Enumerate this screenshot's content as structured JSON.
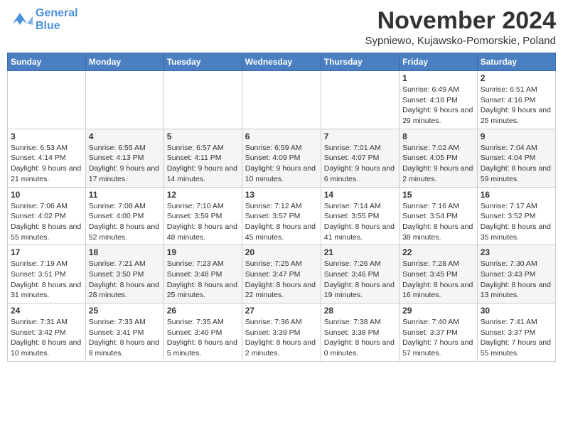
{
  "logo": {
    "line1": "General",
    "line2": "Blue"
  },
  "title": "November 2024",
  "location": "Sypniewo, Kujawsko-Pomorskie, Poland",
  "days_of_week": [
    "Sunday",
    "Monday",
    "Tuesday",
    "Wednesday",
    "Thursday",
    "Friday",
    "Saturday"
  ],
  "weeks": [
    {
      "days": [
        {
          "num": "",
          "info": ""
        },
        {
          "num": "",
          "info": ""
        },
        {
          "num": "",
          "info": ""
        },
        {
          "num": "",
          "info": ""
        },
        {
          "num": "",
          "info": ""
        },
        {
          "num": "1",
          "info": "Sunrise: 6:49 AM\nSunset: 4:18 PM\nDaylight: 9 hours and 29 minutes."
        },
        {
          "num": "2",
          "info": "Sunrise: 6:51 AM\nSunset: 4:16 PM\nDaylight: 9 hours and 25 minutes."
        }
      ]
    },
    {
      "days": [
        {
          "num": "3",
          "info": "Sunrise: 6:53 AM\nSunset: 4:14 PM\nDaylight: 9 hours and 21 minutes."
        },
        {
          "num": "4",
          "info": "Sunrise: 6:55 AM\nSunset: 4:13 PM\nDaylight: 9 hours and 17 minutes."
        },
        {
          "num": "5",
          "info": "Sunrise: 6:57 AM\nSunset: 4:11 PM\nDaylight: 9 hours and 14 minutes."
        },
        {
          "num": "6",
          "info": "Sunrise: 6:59 AM\nSunset: 4:09 PM\nDaylight: 9 hours and 10 minutes."
        },
        {
          "num": "7",
          "info": "Sunrise: 7:01 AM\nSunset: 4:07 PM\nDaylight: 9 hours and 6 minutes."
        },
        {
          "num": "8",
          "info": "Sunrise: 7:02 AM\nSunset: 4:05 PM\nDaylight: 9 hours and 2 minutes."
        },
        {
          "num": "9",
          "info": "Sunrise: 7:04 AM\nSunset: 4:04 PM\nDaylight: 8 hours and 59 minutes."
        }
      ]
    },
    {
      "days": [
        {
          "num": "10",
          "info": "Sunrise: 7:06 AM\nSunset: 4:02 PM\nDaylight: 8 hours and 55 minutes."
        },
        {
          "num": "11",
          "info": "Sunrise: 7:08 AM\nSunset: 4:00 PM\nDaylight: 8 hours and 52 minutes."
        },
        {
          "num": "12",
          "info": "Sunrise: 7:10 AM\nSunset: 3:59 PM\nDaylight: 8 hours and 48 minutes."
        },
        {
          "num": "13",
          "info": "Sunrise: 7:12 AM\nSunset: 3:57 PM\nDaylight: 8 hours and 45 minutes."
        },
        {
          "num": "14",
          "info": "Sunrise: 7:14 AM\nSunset: 3:55 PM\nDaylight: 8 hours and 41 minutes."
        },
        {
          "num": "15",
          "info": "Sunrise: 7:16 AM\nSunset: 3:54 PM\nDaylight: 8 hours and 38 minutes."
        },
        {
          "num": "16",
          "info": "Sunrise: 7:17 AM\nSunset: 3:52 PM\nDaylight: 8 hours and 35 minutes."
        }
      ]
    },
    {
      "days": [
        {
          "num": "17",
          "info": "Sunrise: 7:19 AM\nSunset: 3:51 PM\nDaylight: 8 hours and 31 minutes."
        },
        {
          "num": "18",
          "info": "Sunrise: 7:21 AM\nSunset: 3:50 PM\nDaylight: 8 hours and 28 minutes."
        },
        {
          "num": "19",
          "info": "Sunrise: 7:23 AM\nSunset: 3:48 PM\nDaylight: 8 hours and 25 minutes."
        },
        {
          "num": "20",
          "info": "Sunrise: 7:25 AM\nSunset: 3:47 PM\nDaylight: 8 hours and 22 minutes."
        },
        {
          "num": "21",
          "info": "Sunrise: 7:26 AM\nSunset: 3:46 PM\nDaylight: 8 hours and 19 minutes."
        },
        {
          "num": "22",
          "info": "Sunrise: 7:28 AM\nSunset: 3:45 PM\nDaylight: 8 hours and 16 minutes."
        },
        {
          "num": "23",
          "info": "Sunrise: 7:30 AM\nSunset: 3:43 PM\nDaylight: 8 hours and 13 minutes."
        }
      ]
    },
    {
      "days": [
        {
          "num": "24",
          "info": "Sunrise: 7:31 AM\nSunset: 3:42 PM\nDaylight: 8 hours and 10 minutes."
        },
        {
          "num": "25",
          "info": "Sunrise: 7:33 AM\nSunset: 3:41 PM\nDaylight: 8 hours and 8 minutes."
        },
        {
          "num": "26",
          "info": "Sunrise: 7:35 AM\nSunset: 3:40 PM\nDaylight: 8 hours and 5 minutes."
        },
        {
          "num": "27",
          "info": "Sunrise: 7:36 AM\nSunset: 3:39 PM\nDaylight: 8 hours and 2 minutes."
        },
        {
          "num": "28",
          "info": "Sunrise: 7:38 AM\nSunset: 3:38 PM\nDaylight: 8 hours and 0 minutes."
        },
        {
          "num": "29",
          "info": "Sunrise: 7:40 AM\nSunset: 3:37 PM\nDaylight: 7 hours and 57 minutes."
        },
        {
          "num": "30",
          "info": "Sunrise: 7:41 AM\nSunset: 3:37 PM\nDaylight: 7 hours and 55 minutes."
        }
      ]
    }
  ]
}
